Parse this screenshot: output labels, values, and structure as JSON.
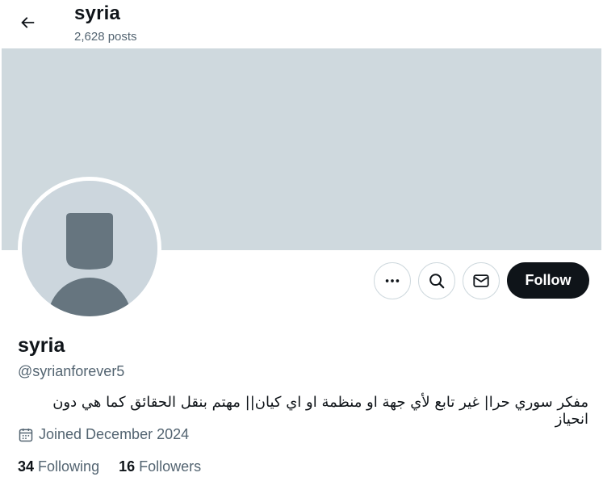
{
  "header": {
    "title": "syria",
    "post_count": "2,628 posts",
    "back_icon": "arrow-left-icon"
  },
  "banner": {
    "color": "#cfd9de"
  },
  "avatar": {
    "icon": "default-avatar-icon"
  },
  "actions": {
    "more_icon": "more-dots-icon",
    "search_icon": "search-icon",
    "message_icon": "envelope-icon",
    "follow_label": "Follow"
  },
  "profile": {
    "name": "syria",
    "handle": "@syrianforever5",
    "bio": "مفكر سوري حرا| غير تابع لأي جهة او منظمة او اي كيان|| مهتم بنقل الحقائق كما هي دون انحياز",
    "joined": "Joined December 2024",
    "joined_icon": "calendar-icon",
    "following_count": "34",
    "following_label": "Following",
    "followers_count": "16",
    "followers_label": "Followers"
  },
  "colors": {
    "text_primary": "#0f1419",
    "text_secondary": "#536471",
    "border": "#cfd9de",
    "follow_bg": "#0f1419"
  }
}
